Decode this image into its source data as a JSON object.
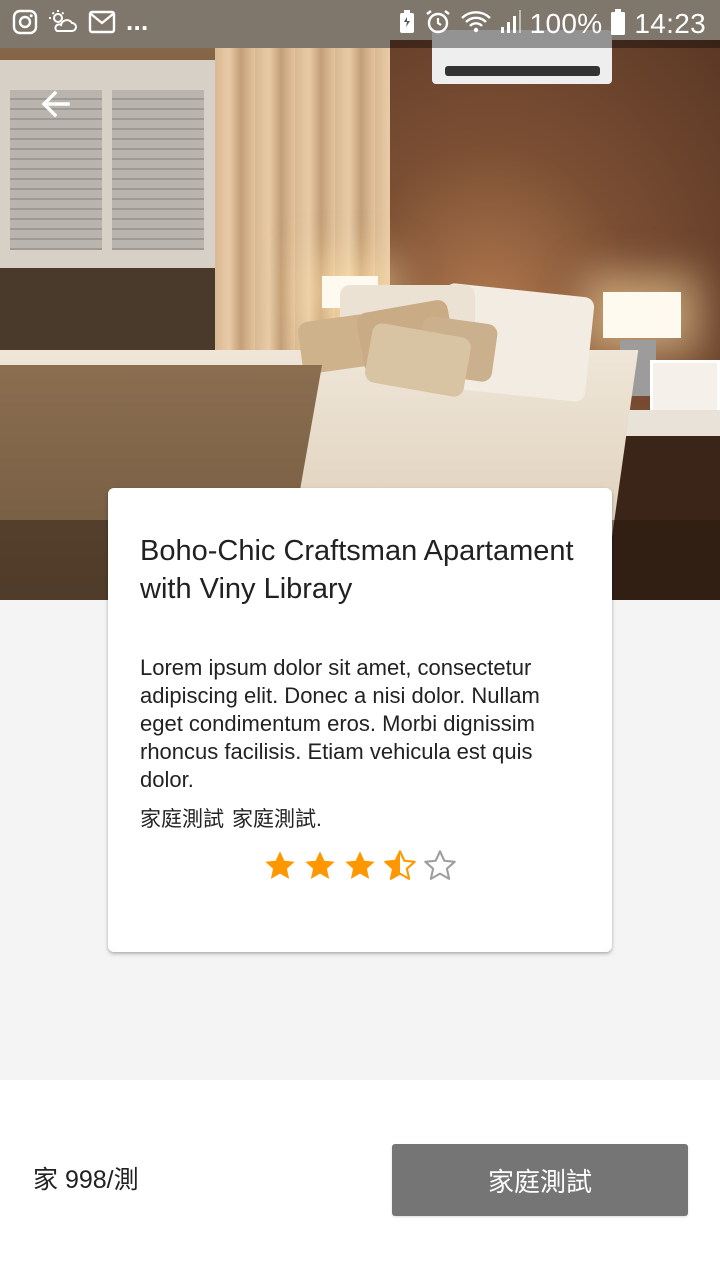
{
  "status_bar": {
    "battery_percent": "100%",
    "time": "14:23",
    "overflow": "...",
    "left_icons": [
      "instagram-icon",
      "weather-icon",
      "gmail-icon"
    ],
    "right_icons": [
      "battery-saver-icon",
      "alarm-icon",
      "wifi-icon",
      "signal-icon",
      "battery-icon"
    ]
  },
  "header": {
    "back_icon": "arrow-left-icon",
    "hero_image": "bedroom-photo"
  },
  "card": {
    "title": "Boho-Chic Craftsman Apartament with Viny Library",
    "description": "Lorem ipsum dolor sit amet, consectetur adipiscing elit. Donec a nisi dolor. Nullam eget condimentum eros. Morbi dignissim rhoncus facilisis. Etiam vehicula est quis dolor.",
    "tag_1": "家庭測試",
    "tag_2": "家庭測試.",
    "rating": {
      "value": 3.5,
      "max": 5
    }
  },
  "footer": {
    "price": "家 998/測",
    "action_label": "家庭測試"
  },
  "colors": {
    "star": "#FF9800",
    "star_empty": "#9E9E9E",
    "button": "#757575",
    "background": "#F4F4F4"
  }
}
